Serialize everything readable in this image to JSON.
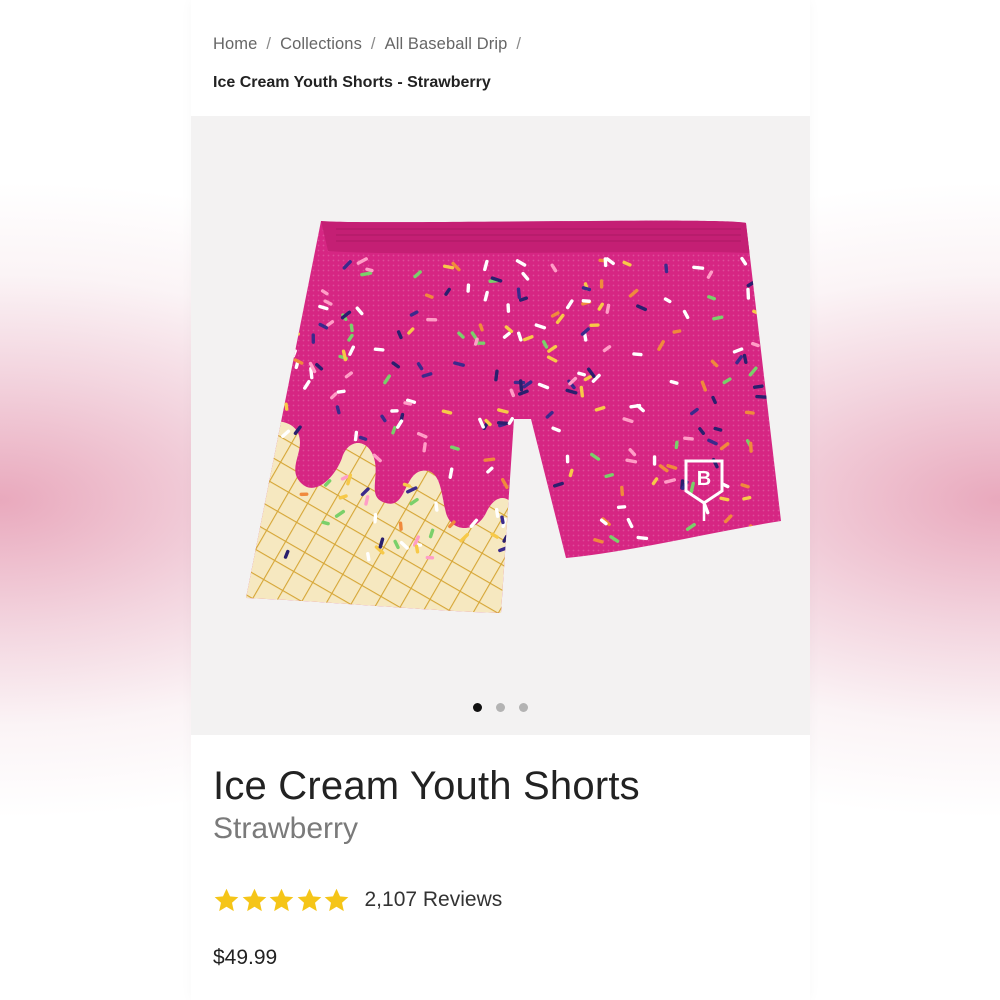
{
  "breadcrumb": {
    "items": [
      "Home",
      "Collections",
      "All Baseball Drip"
    ],
    "separator": "/",
    "current": "Ice Cream Youth Shorts - Strawberry"
  },
  "gallery": {
    "image_alt": "Ice Cream Youth Shorts - Strawberry",
    "slide_count": 3,
    "active_slide": 1
  },
  "product": {
    "title": "Ice Cream Youth Shorts",
    "variant": "Strawberry",
    "rating": 5,
    "rating_max": 5,
    "reviews_label": "2,107 Reviews",
    "price": "$49.99"
  },
  "colors": {
    "star": "#f5c518",
    "shorts_pink": "#d4237f",
    "cone": "#f4e3b5",
    "cone_grid": "#d9ad3c"
  },
  "icons": {
    "star": "star-icon",
    "logo": "baseball-logo-icon"
  }
}
